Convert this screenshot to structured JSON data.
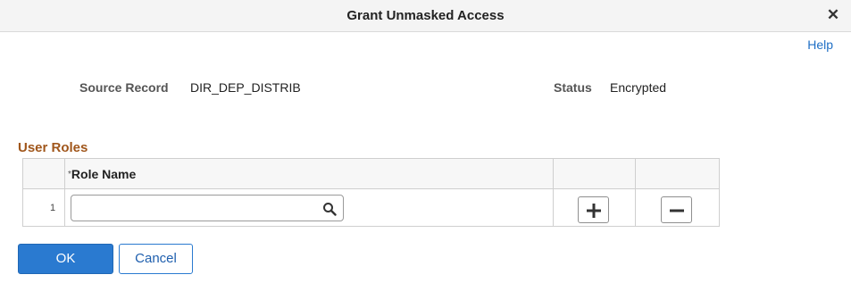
{
  "dialog": {
    "title": "Grant Unmasked Access",
    "close_icon": "close-icon"
  },
  "help": {
    "label": "Help"
  },
  "fields": {
    "source_record_label": "Source Record",
    "source_record_value": "DIR_DEP_DISTRIB",
    "status_label": "Status",
    "status_value": "Encrypted"
  },
  "user_roles": {
    "section_title": "User Roles",
    "columns": {
      "required_marker": "*",
      "role_name": "Role Name"
    },
    "rows": [
      {
        "row_number": "1",
        "role_name": "",
        "search_icon": "search-icon",
        "add_icon": "plus-icon",
        "delete_icon": "minus-icon"
      }
    ]
  },
  "buttons": {
    "ok": "OK",
    "cancel": "Cancel"
  },
  "colors": {
    "accent": "#2a7ad0",
    "section_title": "#a0561b",
    "link": "#1f6fc5"
  }
}
